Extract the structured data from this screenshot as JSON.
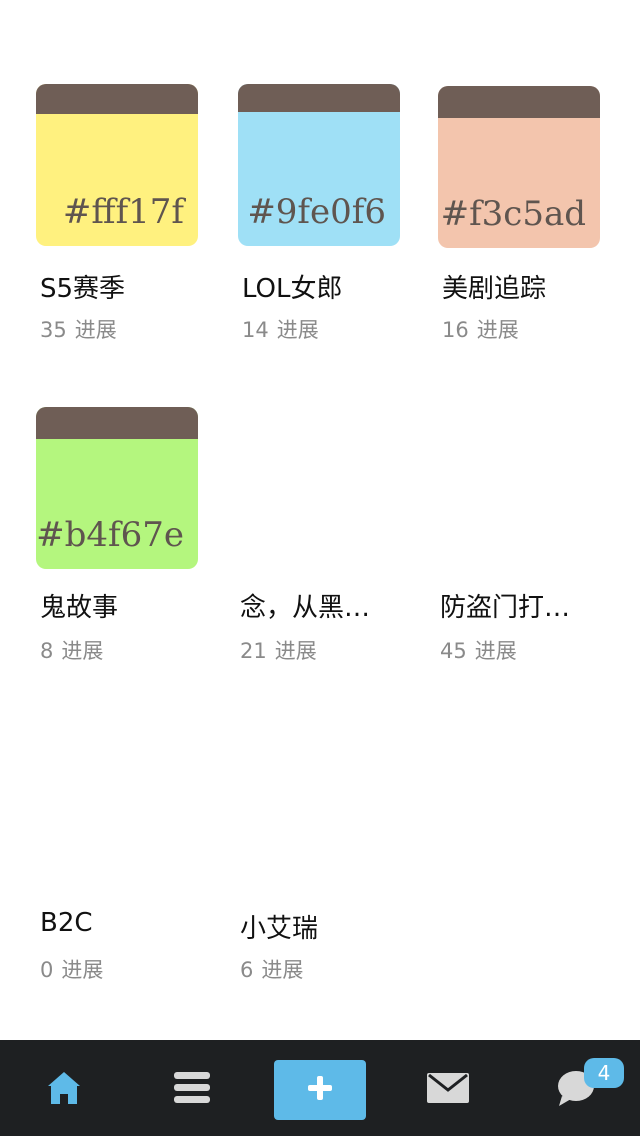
{
  "cards": [
    {
      "hex_label": "#fff17f",
      "color": "#fff17f",
      "title": "S5赛季",
      "count": "35",
      "unit": "进展",
      "has_swatch": true
    },
    {
      "hex_label": "#9fe0f6",
      "color": "#9fe0f6",
      "title": "LOL女郎",
      "count": "14",
      "unit": "进展",
      "has_swatch": true
    },
    {
      "hex_label": "#f3c5ad",
      "color": "#f3c5ad",
      "title": "美剧追踪",
      "count": "16",
      "unit": "进展",
      "has_swatch": true
    },
    {
      "hex_label": "#b4f67e",
      "color": "#b4f67e",
      "title": "鬼故事",
      "count": "8",
      "unit": "进展",
      "has_swatch": true
    },
    {
      "title": "念，从黑…",
      "count": "21",
      "unit": "进展",
      "has_swatch": false
    },
    {
      "title": "防盗门打…",
      "count": "45",
      "unit": "进展",
      "has_swatch": false
    },
    {
      "title": "B2C",
      "count": "0",
      "unit": "进展",
      "has_swatch": false
    },
    {
      "title": "小艾瑞",
      "count": "6",
      "unit": "进展",
      "has_swatch": false
    }
  ],
  "tabbar": {
    "background": "#1e2022",
    "accent": "#5ebae8",
    "items": [
      {
        "icon": "home-icon",
        "active": true
      },
      {
        "icon": "list-icon",
        "active": false
      },
      {
        "icon": "plus-icon",
        "active": false
      },
      {
        "icon": "mail-icon",
        "active": false
      },
      {
        "icon": "chat-bubble-icon",
        "active": false
      }
    ],
    "badge_count": "4"
  },
  "band_color": "#6f5e56"
}
